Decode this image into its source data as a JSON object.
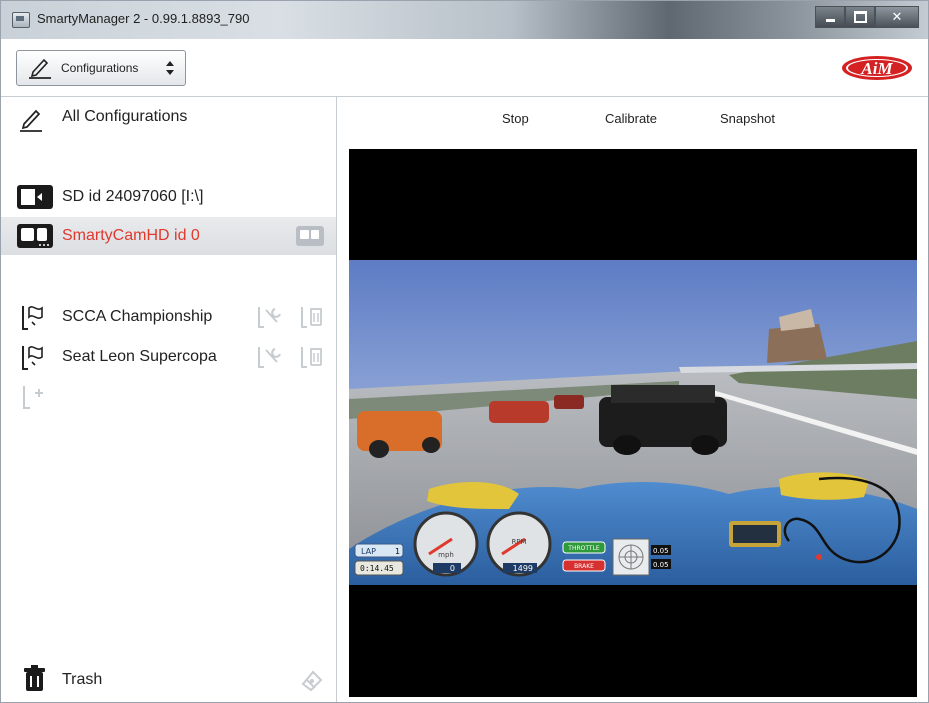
{
  "window": {
    "title": "SmartyManager 2 - 0.99.1.8893_790",
    "controls": [
      "minimize",
      "maximize",
      "close"
    ]
  },
  "toolbar": {
    "configurations_label": "Configurations",
    "logo_text": "AiM"
  },
  "sidebar": {
    "all_configurations": "All Configurations",
    "devices": [
      {
        "label": "SD id 24097060 [I:\\]",
        "icon": "sd-card-icon",
        "selected": false
      },
      {
        "label": "SmartyCamHD id 0",
        "icon": "camera-icon",
        "selected": true
      }
    ],
    "configurations": [
      {
        "label": "SCCA Championship",
        "icon": "race-flag-icon"
      },
      {
        "label": "Seat Leon Supercopa",
        "icon": "race-flag-icon"
      }
    ],
    "trash_label": "Trash"
  },
  "actions": {
    "stop": "Stop",
    "calibrate": "Calibrate",
    "snapshot": "Snapshot"
  },
  "video": {
    "lap_label": "LAP",
    "lap_value": "1",
    "lap_time": "0:14.45",
    "speed_value": "0",
    "speed_unit": "mph",
    "rpm_value": "1499",
    "rpm_unit": "RPM",
    "throttle_label": "THROTTLE",
    "brake_label": "BRAKE",
    "g_lat": "0.05",
    "g_lon": "0.05"
  },
  "colors": {
    "selected_text": "#e0392e",
    "logo_red": "#d42121",
    "throttle_green": "#2f9a3a",
    "brake_red": "#d63030"
  }
}
